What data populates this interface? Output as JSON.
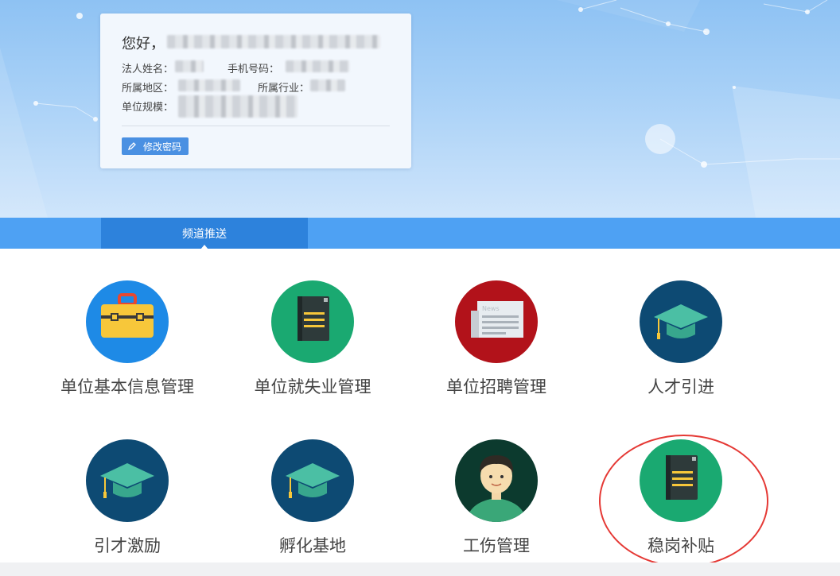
{
  "profile": {
    "greeting": "您好，",
    "legal_person_label": "法人姓名：",
    "phone_label": "手机号码：",
    "region_label": "所属地区：",
    "industry_label": "所属行业：",
    "scale_label": "单位规模：",
    "change_password_label": "修改密码"
  },
  "tabs": [
    {
      "label": "频道推送",
      "active": true
    }
  ],
  "channels": [
    {
      "label": "单位基本信息管理",
      "icon": "briefcase-icon",
      "bg": "#1e8ae6"
    },
    {
      "label": "单位就失业管理",
      "icon": "notebook-icon",
      "bg": "#1aa971"
    },
    {
      "label": "单位招聘管理",
      "icon": "newspaper-icon",
      "bg": "#b2121a"
    },
    {
      "label": "人才引进",
      "icon": "graduation-cap-icon",
      "bg": "#0d4a73"
    },
    {
      "label": "引才激励",
      "icon": "graduation-cap-icon",
      "bg": "#0d4a73"
    },
    {
      "label": "孵化基地",
      "icon": "graduation-cap-icon",
      "bg": "#0d4a73"
    },
    {
      "label": "工伤管理",
      "icon": "worker-avatar-icon",
      "bg": "#0c3a2e"
    },
    {
      "label": "稳岗补贴",
      "icon": "notebook-icon",
      "bg": "#1aa971",
      "highlighted": true
    }
  ],
  "colors": {
    "tab_bar": "#4ea1f3",
    "tab_active": "#2d82dc",
    "button": "#4a90e2",
    "highlight_ring": "#e53935"
  }
}
